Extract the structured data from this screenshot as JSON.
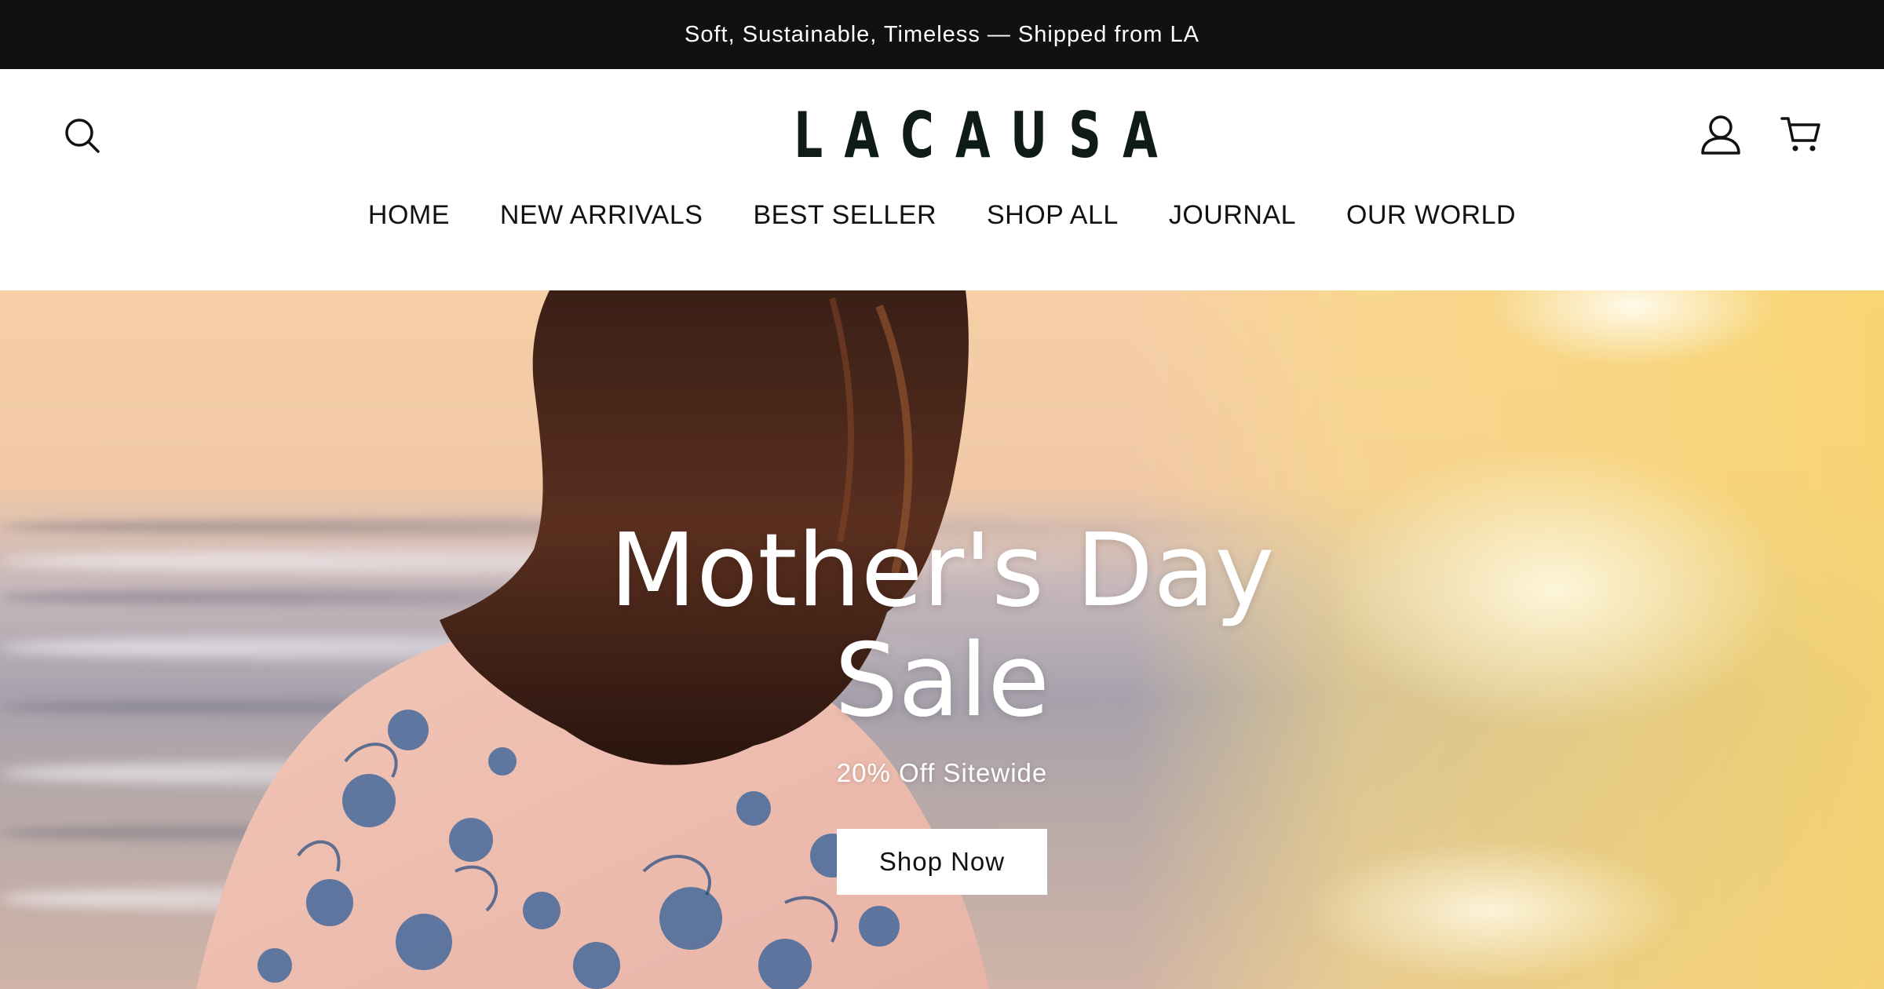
{
  "announcement": {
    "text": "Soft, Sustainable, Timeless — Shipped from LA"
  },
  "header": {
    "logo_text": "LACAUSA",
    "icons": {
      "search": "search-icon",
      "account": "user-icon",
      "cart": "cart-icon"
    }
  },
  "nav": {
    "items": [
      {
        "label": "HOME"
      },
      {
        "label": "NEW ARRIVALS"
      },
      {
        "label": "BEST SELLER"
      },
      {
        "label": "SHOP ALL"
      },
      {
        "label": "JOURNAL"
      },
      {
        "label": "OUR WORLD"
      }
    ]
  },
  "hero": {
    "title_line1": "Mother's Day",
    "title_line2": "Sale",
    "subtitle": "20% Off Sitewide",
    "cta_label": "Shop Now"
  },
  "colors": {
    "announcement_bg": "#111111",
    "logo": "#0f1b17",
    "cta_bg": "#ffffff",
    "hero_text": "#ffffff"
  }
}
